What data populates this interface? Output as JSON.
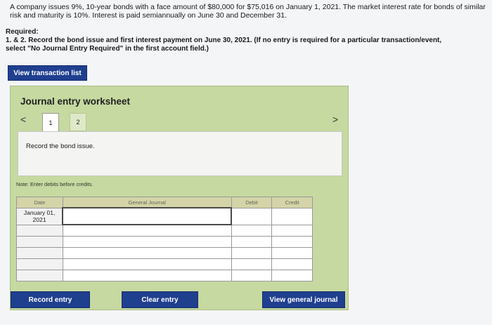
{
  "problem": {
    "text": "A company issues 9%, 10-year bonds with a face amount of $80,000 for $75,016 on January 1, 2021. The market interest rate for bonds of similar risk and maturity is 10%. Interest is paid semiannually on June 30 and December 31."
  },
  "required": {
    "heading": "Required:",
    "line1": "1. & 2. Record the bond issue and first interest payment on June 30, 2021.",
    "line1_bold": " (If no entry is required for a particular transaction/event,",
    "line2": "select \"No Journal Entry Required\" in the first account field.)"
  },
  "buttons": {
    "view_transactions": "View transaction list",
    "record": "Record entry",
    "clear": "Clear entry",
    "view_journal": "View general journal"
  },
  "worksheet": {
    "title": "Journal entry worksheet",
    "tabs": [
      "1",
      "2"
    ],
    "active_tab": "1",
    "prev_icon": "<",
    "next_icon": ">",
    "description": "Record the bond issue.",
    "note": "Note: Enter debits before credits.",
    "table": {
      "headers": [
        "Date",
        "General Journal",
        "Debit",
        "Credit"
      ],
      "rows": [
        {
          "date": "January 01, 2021"
        },
        {
          "date": ""
        },
        {
          "date": ""
        },
        {
          "date": ""
        },
        {
          "date": ""
        },
        {
          "date": ""
        }
      ]
    }
  }
}
